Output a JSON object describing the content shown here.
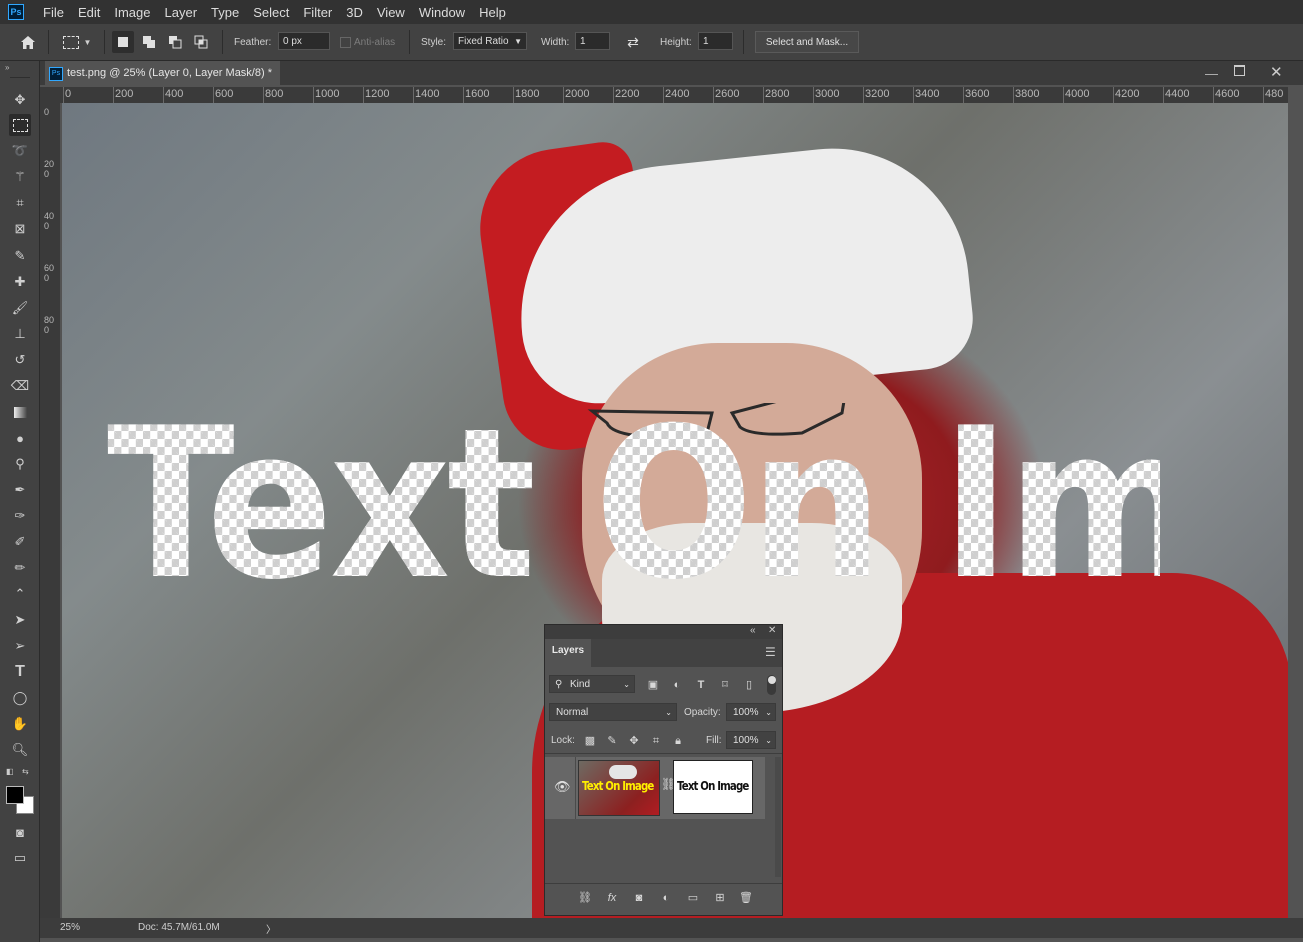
{
  "app": {
    "logo": "Ps"
  },
  "menu": [
    "File",
    "Edit",
    "Image",
    "Layer",
    "Type",
    "Select",
    "Filter",
    "3D",
    "View",
    "Window",
    "Help"
  ],
  "options": {
    "feather_label": "Feather:",
    "feather_value": "0 px",
    "antialias_label": "Anti-alias",
    "style_label": "Style:",
    "style_value": "Fixed Ratio",
    "width_label": "Width:",
    "width_value": "1",
    "height_label": "Height:",
    "height_value": "1",
    "select_mask_label": "Select and Mask..."
  },
  "document": {
    "tab_title": "test.png @ 25% (Layer 0, Layer Mask/8) *",
    "canvas_text": "Text On Image"
  },
  "ruler": {
    "h_ticks": [
      "0",
      "200",
      "400",
      "600",
      "800",
      "1000",
      "1200",
      "1400",
      "1600",
      "1800",
      "2000",
      "2200",
      "2400",
      "2600",
      "2800",
      "3000",
      "3200",
      "3400",
      "3600",
      "3800",
      "4000",
      "4200",
      "4400",
      "4600",
      "480"
    ],
    "v_ticks": [
      "0",
      "200",
      "400",
      "600",
      "800"
    ]
  },
  "status": {
    "zoom": "25%",
    "doc": "Doc: 45.7M/61.0M",
    "arrow": "〉"
  },
  "layers_panel": {
    "tab": "Layers",
    "filter_kind": "Kind",
    "blend_mode": "Normal",
    "opacity_label": "Opacity:",
    "opacity_value": "100%",
    "lock_label": "Lock:",
    "fill_label": "Fill:",
    "fill_value": "100%",
    "thumb_text": "Text On Image"
  },
  "colors": {
    "accent": "#31a8ff",
    "thumb_text_yellow": "#ffee00"
  },
  "icons": {
    "tools": [
      "move-icon",
      "marquee-icon",
      "lasso-icon",
      "magic-wand-icon",
      "crop-icon",
      "frame-icon",
      "eyedropper-icon",
      "healing-brush-icon",
      "brush-icon",
      "clone-stamp-icon",
      "history-brush-icon",
      "eraser-icon",
      "gradient-icon",
      "blur-icon",
      "dodge-icon",
      "pen-icon",
      "freeform-pen-icon",
      "add-anchor-icon",
      "delete-anchor-icon",
      "convert-point-icon",
      "path-select-icon",
      "direct-select-icon",
      "type-icon",
      "ellipse-icon",
      "hand-icon",
      "zoom-icon"
    ]
  }
}
